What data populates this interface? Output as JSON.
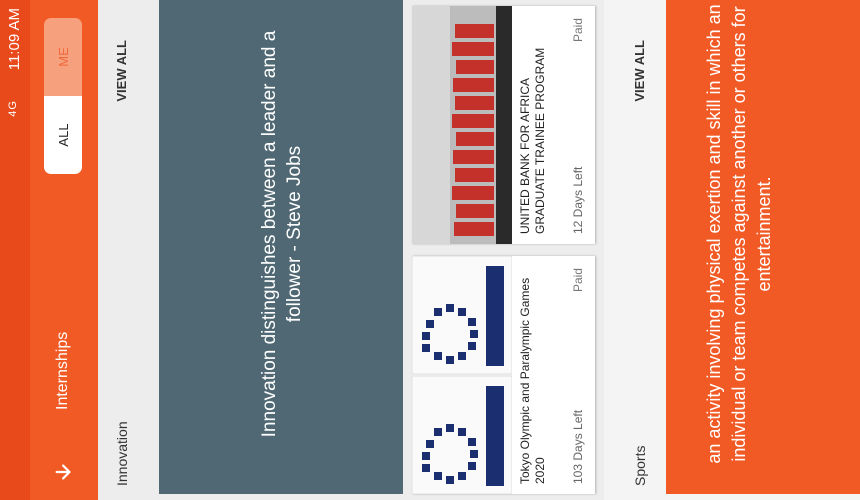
{
  "status_bar": {
    "time": "11:09 AM",
    "signal": "4G"
  },
  "app_bar": {
    "title": "Internships",
    "toggle": {
      "all_label": "ALL",
      "me_label": "ME"
    }
  },
  "sections": {
    "innovation": {
      "title": "Innovation",
      "view_all": "VIEW ALL",
      "banner_text": "Innovation distinguishes between a leader and a follower - Steve Jobs"
    },
    "cards": [
      {
        "title": "Tokyo Olympic and Paralympic Games 2020",
        "days_left": "103 Days Left",
        "type": "Paid"
      },
      {
        "title": "UNITED BANK FOR AFRICA GRADUATE TRAINEE PROGRAM",
        "days_left": "12 Days Left",
        "type": "Paid"
      }
    ],
    "sports": {
      "title": "Sports",
      "view_all": "VIEW ALL",
      "banner_text": "an activity involving physical exertion and skill in which an individual or team competes against another or others for entertainment."
    }
  },
  "colors": {
    "primary": "#f25a25",
    "status": "#e94a1c",
    "banner": "#4f6873"
  }
}
